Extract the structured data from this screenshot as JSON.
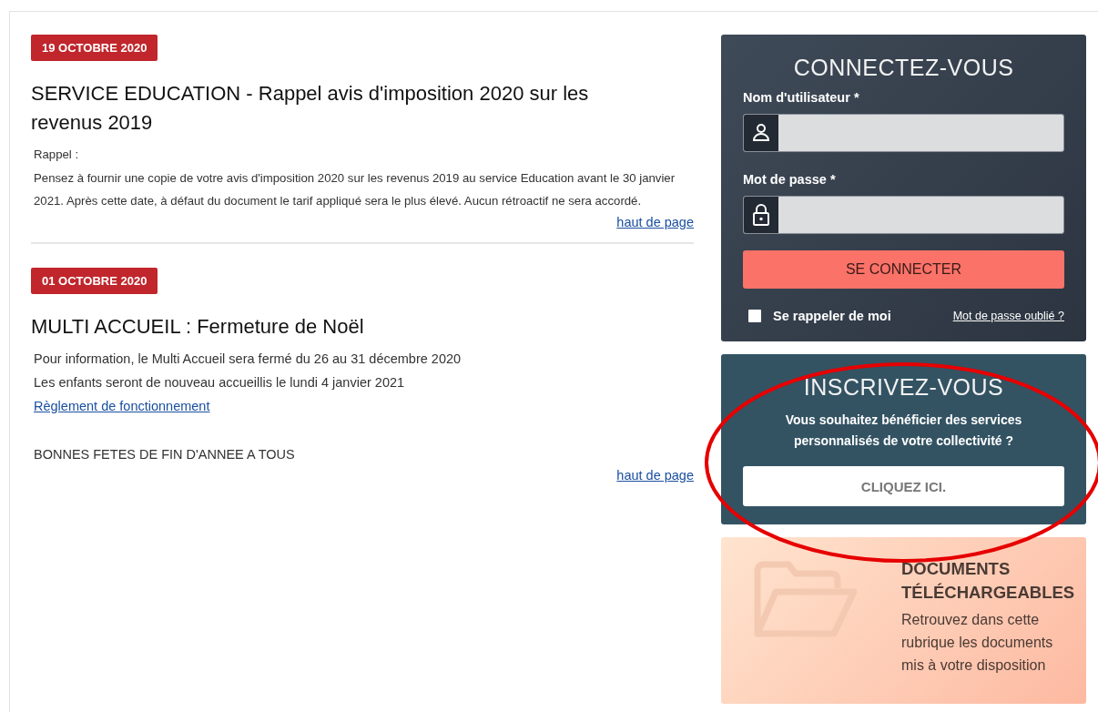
{
  "articles": [
    {
      "date": "19 OCTOBRE 2020",
      "title": "SERVICE EDUCATION - Rappel avis d'imposition 2020 sur les revenus 2019",
      "small": true,
      "paragraphs": [
        {
          "kind": "text",
          "text": "Rappel :"
        },
        {
          "kind": "text",
          "text": "Pensez à fournir une copie de votre avis d'imposition 2020 sur les revenus 2019 au service Education avant le 30 janvier 2021. Après cette date, à défaut du document le tarif appliqué sera le plus élevé. Aucun rétroactif ne sera accordé."
        }
      ],
      "top_link": "haut de page"
    },
    {
      "date": "01 OCTOBRE 2020",
      "title": "MULTI ACCUEIL : Fermeture de Noël",
      "small": false,
      "paragraphs": [
        {
          "kind": "text",
          "text": "Pour information, le Multi Accueil sera fermé du 26 au 31 décembre 2020"
        },
        {
          "kind": "text",
          "text": "Les enfants seront de nouveau accueillis le lundi 4 janvier 2021"
        },
        {
          "kind": "link",
          "text": "Règlement de fonctionnement"
        },
        {
          "kind": "closing",
          "text": "BONNES FETES DE FIN D'ANNEE A TOUS"
        }
      ],
      "top_link": "haut de page"
    }
  ],
  "login": {
    "title": "CONNECTEZ-VOUS",
    "username_label": "Nom d'utilisateur *",
    "password_label": "Mot de passe *",
    "submit": "SE CONNECTER",
    "remember": {
      "label": "Se rappeler de moi",
      "checked": false
    },
    "forgot": "Mot de passe oublié ?"
  },
  "register": {
    "title": "INSCRIVEZ-VOUS",
    "text": "Vous souhaitez bénéficier des services personnalisés de votre collectivité ?",
    "button": "CLIQUEZ ICI."
  },
  "documents": {
    "title": "DOCUMENTS TÉLÉCHARGEABLES",
    "text": "Retrouvez dans cette rubrique les documents mis à votre disposition"
  }
}
